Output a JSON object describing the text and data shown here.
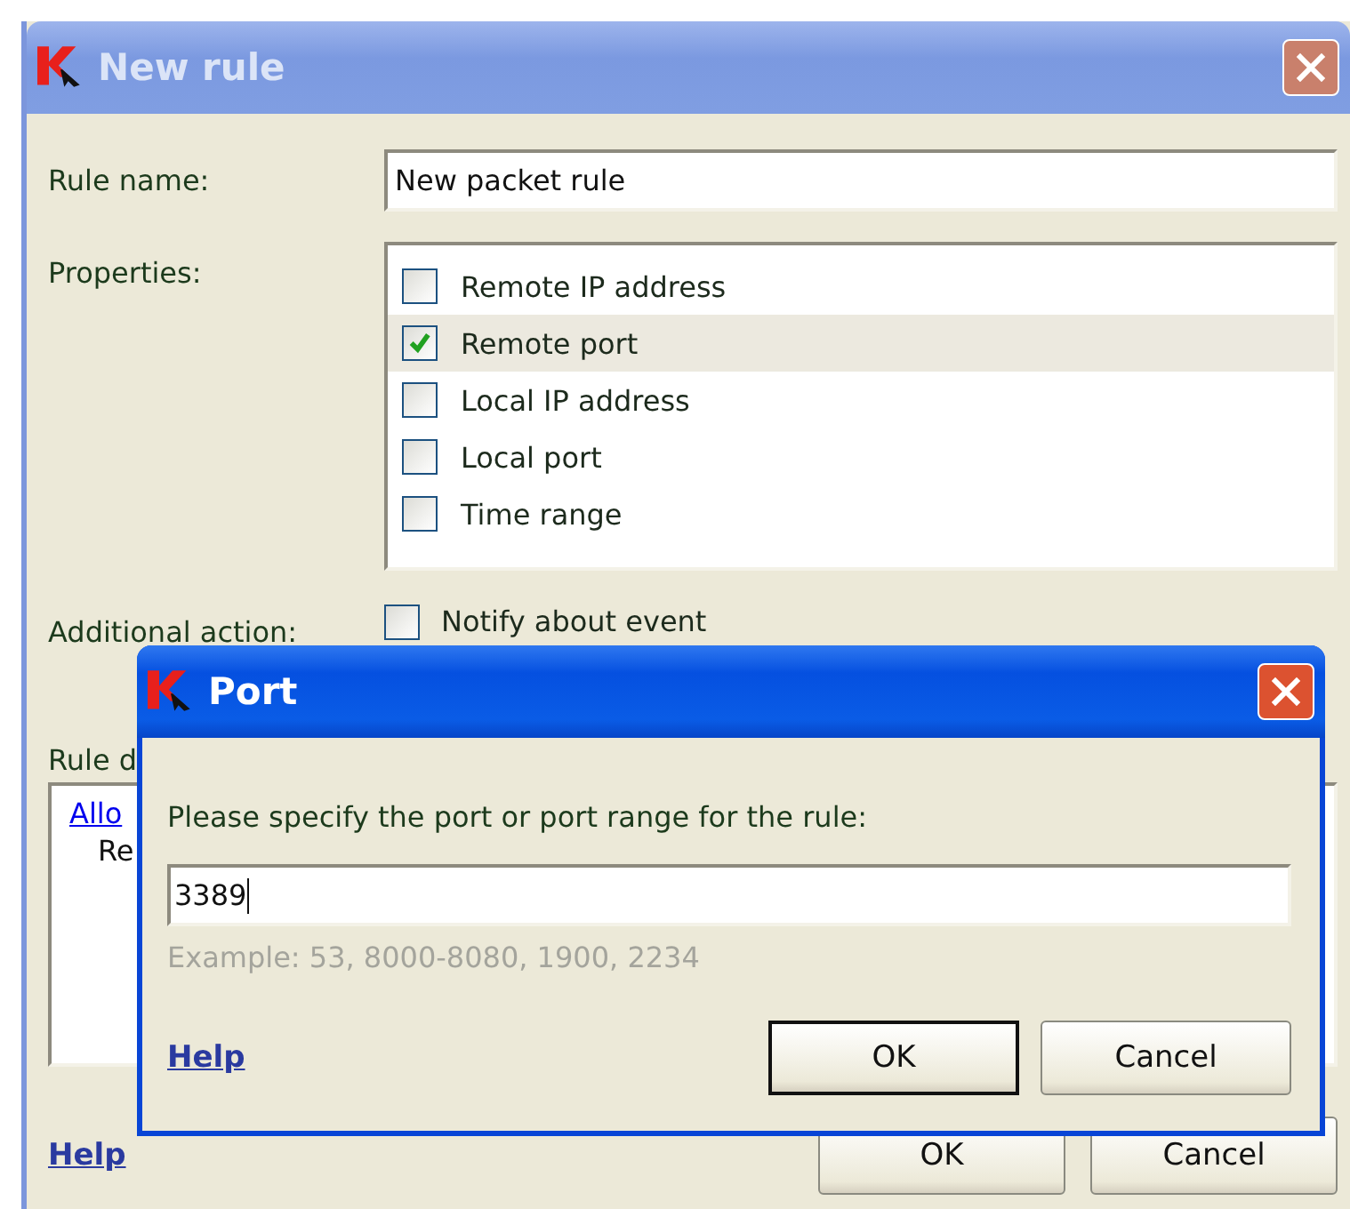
{
  "window": {
    "title": "New rule",
    "active": false
  },
  "rule_name": {
    "label": "Rule name:",
    "value": "New packet rule"
  },
  "properties": {
    "label": "Properties:",
    "items": [
      {
        "label": "Remote IP address",
        "checked": false,
        "selected": false
      },
      {
        "label": "Remote port",
        "checked": true,
        "selected": true
      },
      {
        "label": "Local IP address",
        "checked": false,
        "selected": false
      },
      {
        "label": "Local port",
        "checked": false,
        "selected": false
      },
      {
        "label": "Time range",
        "checked": false,
        "selected": false
      }
    ]
  },
  "additional_action": {
    "label": "Additional action:",
    "option": {
      "label": "Notify about event",
      "checked": false
    }
  },
  "rule_description": {
    "label": "Rule d",
    "link": "Allo",
    "line": "Re"
  },
  "help_link": "Help",
  "buttons": [
    "OK",
    "Cancel"
  ],
  "port_dialog": {
    "title": "Port",
    "active": true,
    "prompt": "Please specify the port or port range for the rule:",
    "value": "3389",
    "example": "Example: 53, 8000-8080, 1900, 2234",
    "help_link": "Help",
    "buttons": [
      "OK",
      "Cancel"
    ]
  }
}
